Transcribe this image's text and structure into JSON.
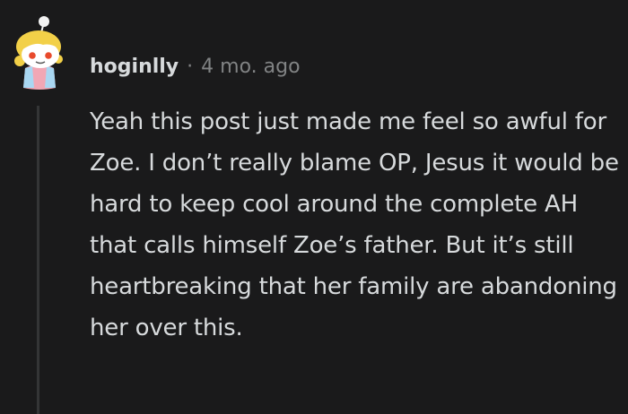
{
  "comment": {
    "avatar_icon": "snoo-avatar-icon",
    "username": "hoginlly",
    "separator": "·",
    "timestamp": "4 mo. ago",
    "body": "Yeah this post just made me feel so awful for Zoe. I don’t really blame OP, Jesus it would be hard to keep cool around the complete AH that calls himself Zoe’s father. But it’s still heartbreaking that her family are abandoning her over this."
  },
  "colors": {
    "background": "#1a1a1b",
    "text": "#d7dadc",
    "meta": "#818384",
    "thread_line": "#343536",
    "avatar_hair": "#f2d048",
    "avatar_eye": "#e84a2c",
    "avatar_shirt": "#a9d7f2"
  }
}
